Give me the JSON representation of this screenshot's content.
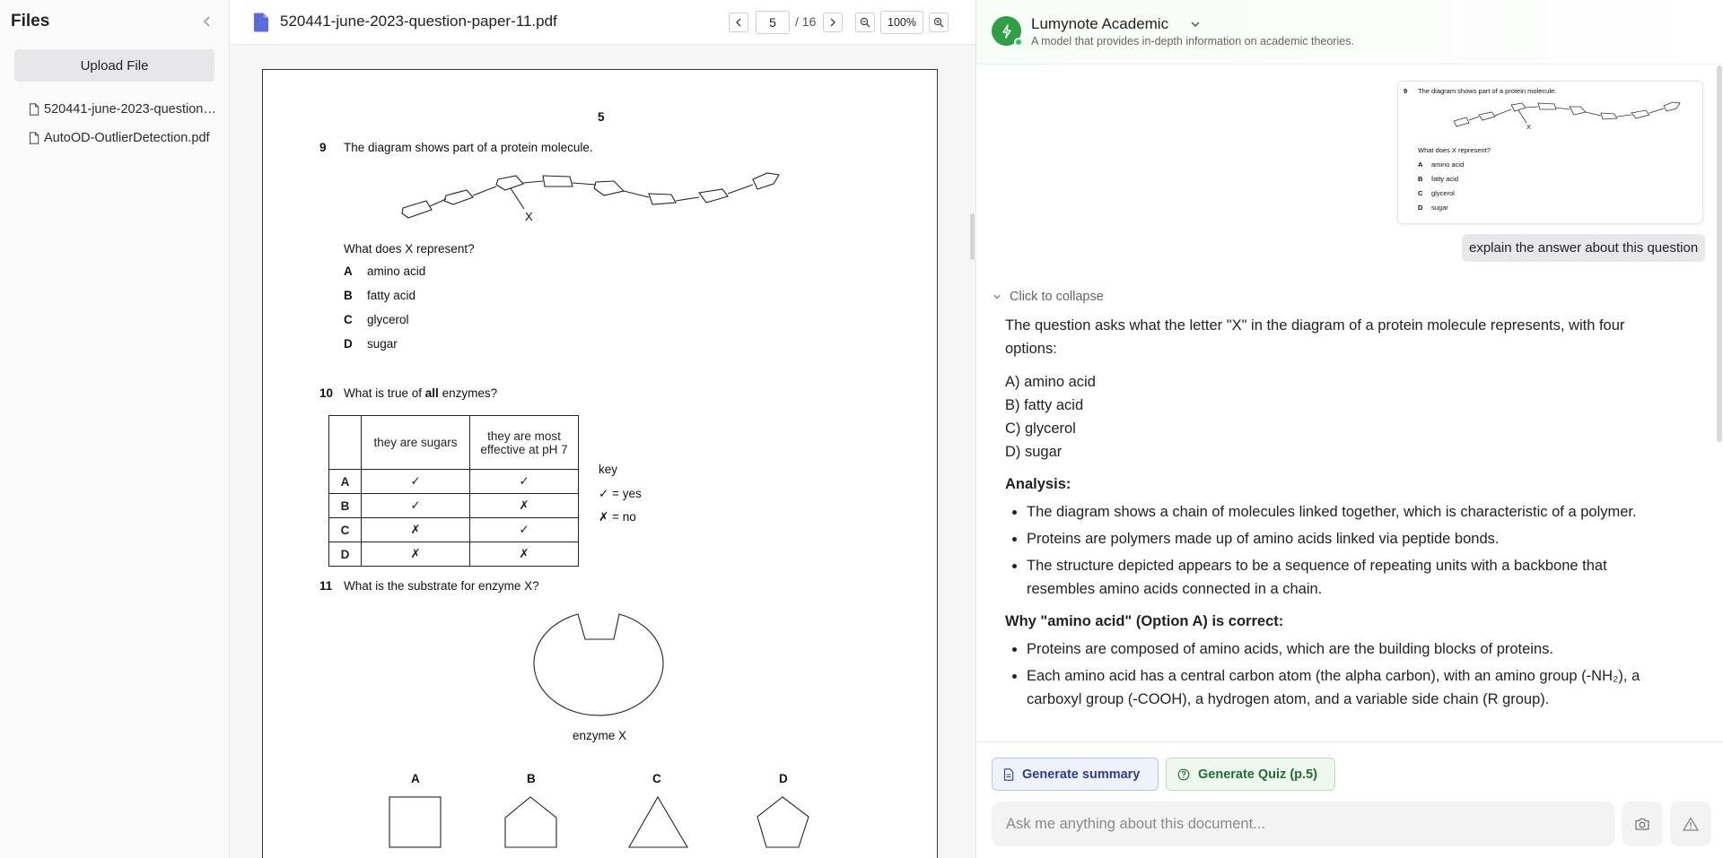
{
  "sidebar": {
    "title": "Files",
    "upload_label": "Upload File",
    "files": [
      {
        "name": "520441-june-2023-question-paper-11.pdf"
      },
      {
        "name": "AutoOD-OutlierDetection.pdf"
      }
    ]
  },
  "viewer": {
    "doc_title": "520441-june-2023-question-paper-11.pdf",
    "current_page": "5",
    "page_total": "/ 16",
    "zoom": "100%",
    "page": {
      "page_number": "5",
      "q9": {
        "num": "9",
        "text": "The diagram shows part of a protein molecule.",
        "marker": "X",
        "question": "What does X represent?",
        "options": [
          {
            "letter": "A",
            "text": "amino acid"
          },
          {
            "letter": "B",
            "text": "fatty acid"
          },
          {
            "letter": "C",
            "text": "glycerol"
          },
          {
            "letter": "D",
            "text": "sugar"
          }
        ]
      },
      "q10": {
        "num": "10",
        "text_pre": "What is true of ",
        "text_bold": "all",
        "text_post": " enzymes?",
        "col1": "they are sugars",
        "col2": "they are most effective at pH 7",
        "rows": [
          {
            "letter": "A",
            "c1": "✓",
            "c2": "✓"
          },
          {
            "letter": "B",
            "c1": "✓",
            "c2": "✗"
          },
          {
            "letter": "C",
            "c1": "✗",
            "c2": "✓"
          },
          {
            "letter": "D",
            "c1": "✗",
            "c2": "✗"
          }
        ],
        "key_title": "key",
        "key_yes": "✓ = yes",
        "key_no": "✗ = no"
      },
      "q11": {
        "num": "11",
        "text": "What is the substrate for enzyme X?",
        "enzyme_label": "enzyme X",
        "shape_labels": [
          "A",
          "B",
          "C",
          "D"
        ]
      }
    }
  },
  "chat": {
    "model_name": "Lumynote Academic",
    "model_desc": "A model that provides in-depth information on academic theories.",
    "thumbnail": {
      "num": "9",
      "text": "The diagram shows part of a protein molecule.",
      "marker": "X",
      "question": "What does X represent?",
      "options": [
        {
          "letter": "A",
          "text": "amino acid"
        },
        {
          "letter": "B",
          "text": "fatty acid"
        },
        {
          "letter": "C",
          "text": "glycerol"
        },
        {
          "letter": "D",
          "text": "sugar"
        }
      ]
    },
    "user_message": "explain the answer about this question",
    "collapse_label": "Click to collapse",
    "answer": {
      "intro": "The question asks what the letter \"X\" in the diagram of a protein molecule represents, with four options:",
      "options": [
        "A) amino acid",
        "B) fatty acid",
        "C) glycerol",
        "D) sugar"
      ],
      "analysis_heading": "Analysis:",
      "analysis_points": [
        "The diagram shows a chain of molecules linked together, which is characteristic of a polymer.",
        "Proteins are polymers made up of amino acids linked via peptide bonds.",
        "The structure depicted appears to be a sequence of repeating units with a backbone that resembles amino acids connected in a chain."
      ],
      "why_heading": "Why \"amino acid\" (Option A) is correct:",
      "why_points": [
        "Proteins are composed of amino acids, which are the building blocks of proteins.",
        "Each amino acid has a central carbon atom (the alpha carbon), with an amino group (-NH₂), a carboxyl group (-COOH), a hydrogen atom, and a variable side chain (R group)."
      ]
    },
    "actions": {
      "summary_label": "Generate summary",
      "quiz_label": "Generate Quiz (p.5)"
    },
    "input_placeholder": "Ask me anything about this document..."
  },
  "colors": {
    "accent_green": "#2f9e44",
    "pdf_icon": "#5b6bdc",
    "summary_text": "#2f3e8f",
    "quiz_text": "#1f6f2e"
  },
  "icons": [
    "collapse-left-icon",
    "file-icon",
    "pdf-file-icon",
    "prev-page-icon",
    "next-page-icon",
    "zoom-out-icon",
    "zoom-in-icon",
    "lightning-icon",
    "chevron-down-icon",
    "document-icon",
    "help-circle-icon",
    "camera-icon",
    "warning-icon"
  ]
}
